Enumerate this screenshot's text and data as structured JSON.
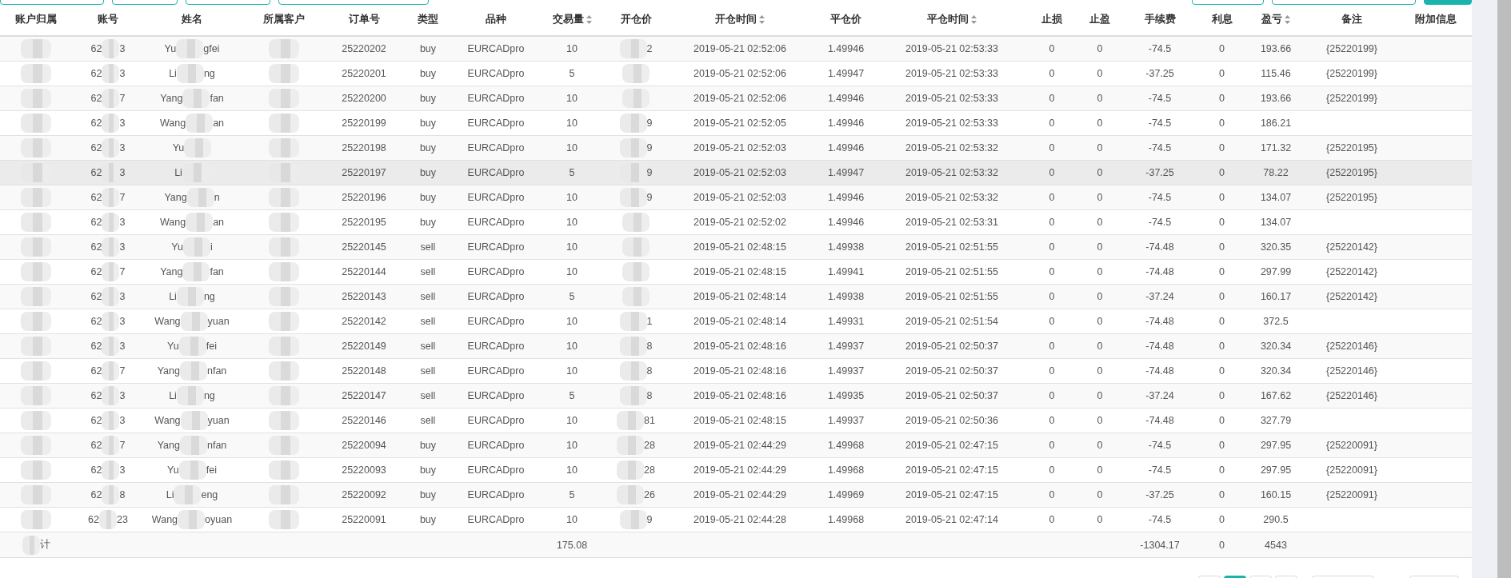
{
  "toolbar_left": [
    {
      "kind": "outline"
    },
    {
      "kind": "outline"
    },
    {
      "kind": "outline"
    },
    {
      "kind": "outline"
    }
  ],
  "toolbar_right": [
    {
      "kind": "outline"
    },
    {
      "kind": "outline"
    },
    {
      "kind": "filled"
    }
  ],
  "columns": [
    {
      "label": "账户归属",
      "sortable": false
    },
    {
      "label": "账号",
      "sortable": false
    },
    {
      "label": "姓名",
      "sortable": false
    },
    {
      "label": "所属客户",
      "sortable": false
    },
    {
      "label": "订单号",
      "sortable": false
    },
    {
      "label": "类型",
      "sortable": false
    },
    {
      "label": "品种",
      "sortable": false
    },
    {
      "label": "交易量",
      "sortable": true
    },
    {
      "label": "开仓价",
      "sortable": false
    },
    {
      "label": "开仓时间",
      "sortable": true
    },
    {
      "label": "平仓价",
      "sortable": false
    },
    {
      "label": "平仓时间",
      "sortable": true
    },
    {
      "label": "止损",
      "sortable": false
    },
    {
      "label": "止盈",
      "sortable": false
    },
    {
      "label": "手续费",
      "sortable": false
    },
    {
      "label": "利息",
      "sortable": false
    },
    {
      "label": "盈亏",
      "sortable": true
    },
    {
      "label": "备注",
      "sortable": false
    },
    {
      "label": "附加信息",
      "sortable": false
    }
  ],
  "rows": [
    {
      "account": [
        "62",
        "3"
      ],
      "name": [
        "Yu",
        "gfei"
      ],
      "order": "25220202",
      "type": "buy",
      "symbol": "EURCADpro",
      "volume": "10",
      "open_price": "2",
      "open_time": "2019-05-21 02:52:06",
      "close_price": "1.49946",
      "close_time": "2019-05-21 02:53:33",
      "sl": "0",
      "tp": "0",
      "fee": "-74.5",
      "interest": "0",
      "pnl": "193.66",
      "note": "{25220199}",
      "hovered": false
    },
    {
      "account": [
        "62",
        "3"
      ],
      "name": [
        "Li",
        "ng"
      ],
      "order": "25220201",
      "type": "buy",
      "symbol": "EURCADpro",
      "volume": "5",
      "open_time": "2019-05-21 02:52:06",
      "close_price": "1.49947",
      "close_time": "2019-05-21 02:53:33",
      "sl": "0",
      "tp": "0",
      "fee": "-37.25",
      "interest": "0",
      "pnl": "115.46",
      "note": "{25220199}",
      "hovered": false
    },
    {
      "account": [
        "62",
        "7"
      ],
      "name": [
        "Yang",
        "fan"
      ],
      "order": "25220200",
      "type": "buy",
      "symbol": "EURCADpro",
      "volume": "10",
      "open_time": "2019-05-21 02:52:06",
      "close_price": "1.49946",
      "close_time": "2019-05-21 02:53:33",
      "sl": "0",
      "tp": "0",
      "fee": "-74.5",
      "interest": "0",
      "pnl": "193.66",
      "note": "{25220199}",
      "hovered": false
    },
    {
      "account": [
        "62",
        "3"
      ],
      "name": [
        "Wang",
        "an"
      ],
      "order": "25220199",
      "type": "buy",
      "symbol": "EURCADpro",
      "volume": "10",
      "open_price": "9",
      "open_time": "2019-05-21 02:52:05",
      "close_price": "1.49946",
      "close_time": "2019-05-21 02:53:33",
      "sl": "0",
      "tp": "0",
      "fee": "-74.5",
      "interest": "0",
      "pnl": "186.21",
      "hovered": false
    },
    {
      "account": [
        "62",
        "3"
      ],
      "name": [
        "Yu"
      ],
      "order": "25220198",
      "type": "buy",
      "symbol": "EURCADpro",
      "volume": "10",
      "open_price": "9",
      "open_time": "2019-05-21 02:52:03",
      "close_price": "1.49946",
      "close_time": "2019-05-21 02:53:32",
      "sl": "0",
      "tp": "0",
      "fee": "-74.5",
      "interest": "0",
      "pnl": "171.32",
      "note": "{25220195}",
      "hovered": false
    },
    {
      "account": [
        "62",
        "3"
      ],
      "name": [
        "Li"
      ],
      "order": "25220197",
      "type": "buy",
      "symbol": "EURCADpro",
      "volume": "5",
      "open_price": "9",
      "open_time": "2019-05-21 02:52:03",
      "close_price": "1.49947",
      "close_time": "2019-05-21 02:53:32",
      "sl": "0",
      "tp": "0",
      "fee": "-37.25",
      "interest": "0",
      "pnl": "78.22",
      "note": "{25220195}",
      "hovered": true
    },
    {
      "account": [
        "62",
        "7"
      ],
      "name": [
        "Yang",
        "n"
      ],
      "order": "25220196",
      "type": "buy",
      "symbol": "EURCADpro",
      "volume": "10",
      "open_price": "9",
      "open_time": "2019-05-21 02:52:03",
      "close_price": "1.49946",
      "close_time": "2019-05-21 02:53:32",
      "sl": "0",
      "tp": "0",
      "fee": "-74.5",
      "interest": "0",
      "pnl": "134.07",
      "note": "{25220195}",
      "hovered": false
    },
    {
      "account": [
        "62",
        "3"
      ],
      "name": [
        "Wang",
        "an"
      ],
      "order": "25220195",
      "type": "buy",
      "symbol": "EURCADpro",
      "volume": "10",
      "open_time": "2019-05-21 02:52:02",
      "close_price": "1.49946",
      "close_time": "2019-05-21 02:53:31",
      "sl": "0",
      "tp": "0",
      "fee": "-74.5",
      "interest": "0",
      "pnl": "134.07",
      "hovered": false
    },
    {
      "account": [
        "62",
        "3"
      ],
      "name": [
        "Yu",
        "i"
      ],
      "order": "25220145",
      "type": "sell",
      "symbol": "EURCADpro",
      "volume": "10",
      "open_time": "2019-05-21 02:48:15",
      "close_price": "1.49938",
      "close_time": "2019-05-21 02:51:55",
      "sl": "0",
      "tp": "0",
      "fee": "-74.48",
      "interest": "0",
      "pnl": "320.35",
      "note": "{25220142}",
      "hovered": false
    },
    {
      "account": [
        "62",
        "7"
      ],
      "name": [
        "Yang",
        "fan"
      ],
      "order": "25220144",
      "type": "sell",
      "symbol": "EURCADpro",
      "volume": "10",
      "open_time": "2019-05-21 02:48:15",
      "close_price": "1.49941",
      "close_time": "2019-05-21 02:51:55",
      "sl": "0",
      "tp": "0",
      "fee": "-74.48",
      "interest": "0",
      "pnl": "297.99",
      "note": "{25220142}",
      "hovered": false
    },
    {
      "account": [
        "62",
        "3"
      ],
      "name": [
        "Li",
        "ng"
      ],
      "order": "25220143",
      "type": "sell",
      "symbol": "EURCADpro",
      "volume": "5",
      "open_time": "2019-05-21 02:48:14",
      "close_price": "1.49938",
      "close_time": "2019-05-21 02:51:55",
      "sl": "0",
      "tp": "0",
      "fee": "-37.24",
      "interest": "0",
      "pnl": "160.17",
      "note": "{25220142}",
      "hovered": false
    },
    {
      "account": [
        "62",
        "3"
      ],
      "name": [
        "Wang",
        "yuan"
      ],
      "order": "25220142",
      "type": "sell",
      "symbol": "EURCADpro",
      "volume": "10",
      "open_price": "1",
      "open_time": "2019-05-21 02:48:14",
      "close_price": "1.49931",
      "close_time": "2019-05-21 02:51:54",
      "sl": "0",
      "tp": "0",
      "fee": "-74.48",
      "interest": "0",
      "pnl": "372.5",
      "hovered": false
    },
    {
      "account": [
        "62",
        "3"
      ],
      "name": [
        "Yu",
        "fei"
      ],
      "order": "25220149",
      "type": "sell",
      "symbol": "EURCADpro",
      "volume": "10",
      "open_price": "8",
      "open_time": "2019-05-21 02:48:16",
      "close_price": "1.49937",
      "close_time": "2019-05-21 02:50:37",
      "sl": "0",
      "tp": "0",
      "fee": "-74.48",
      "interest": "0",
      "pnl": "320.34",
      "note": "{25220146}",
      "hovered": false
    },
    {
      "account": [
        "62",
        "7"
      ],
      "name": [
        "Yang",
        "nfan"
      ],
      "order": "25220148",
      "type": "sell",
      "symbol": "EURCADpro",
      "volume": "10",
      "open_price": "8",
      "open_time": "2019-05-21 02:48:16",
      "close_price": "1.49937",
      "close_time": "2019-05-21 02:50:37",
      "sl": "0",
      "tp": "0",
      "fee": "-74.48",
      "interest": "0",
      "pnl": "320.34",
      "note": "{25220146}",
      "hovered": false
    },
    {
      "account": [
        "62",
        "3"
      ],
      "name": [
        "Li",
        "ng"
      ],
      "order": "25220147",
      "type": "sell",
      "symbol": "EURCADpro",
      "volume": "5",
      "open_price": "8",
      "open_time": "2019-05-21 02:48:16",
      "close_price": "1.49935",
      "close_time": "2019-05-21 02:50:37",
      "sl": "0",
      "tp": "0",
      "fee": "-37.24",
      "interest": "0",
      "pnl": "167.62",
      "note": "{25220146}",
      "hovered": false
    },
    {
      "account": [
        "62",
        "3"
      ],
      "name": [
        "Wang",
        "yuan"
      ],
      "order": "25220146",
      "type": "sell",
      "symbol": "EURCADpro",
      "volume": "10",
      "open_price": "81",
      "open_time": "2019-05-21 02:48:15",
      "close_price": "1.49937",
      "close_time": "2019-05-21 02:50:36",
      "sl": "0",
      "tp": "0",
      "fee": "-74.48",
      "interest": "0",
      "pnl": "327.79",
      "hovered": false
    },
    {
      "account": [
        "62",
        "7"
      ],
      "name": [
        "Yang",
        "nfan"
      ],
      "order": "25220094",
      "type": "buy",
      "symbol": "EURCADpro",
      "volume": "10",
      "open_price": "28",
      "open_time": "2019-05-21 02:44:29",
      "close_price": "1.49968",
      "close_time": "2019-05-21 02:47:15",
      "sl": "0",
      "tp": "0",
      "fee": "-74.5",
      "interest": "0",
      "pnl": "297.95",
      "note": "{25220091}",
      "hovered": false
    },
    {
      "account": [
        "62",
        "3"
      ],
      "name": [
        "Yu",
        "fei"
      ],
      "order": "25220093",
      "type": "buy",
      "symbol": "EURCADpro",
      "volume": "10",
      "open_price": "28",
      "open_time": "2019-05-21 02:44:29",
      "close_price": "1.49968",
      "close_time": "2019-05-21 02:47:15",
      "sl": "0",
      "tp": "0",
      "fee": "-74.5",
      "interest": "0",
      "pnl": "297.95",
      "note": "{25220091}",
      "hovered": false
    },
    {
      "account": [
        "62",
        "8"
      ],
      "name": [
        "Li",
        "eng"
      ],
      "order": "25220092",
      "type": "buy",
      "symbol": "EURCADpro",
      "volume": "5",
      "open_price": "26",
      "open_time": "2019-05-21 02:44:29",
      "close_price": "1.49969",
      "close_time": "2019-05-21 02:47:15",
      "sl": "0",
      "tp": "0",
      "fee": "-37.25",
      "interest": "0",
      "pnl": "160.15",
      "note": "{25220091}",
      "hovered": false
    },
    {
      "account": [
        "62",
        "23"
      ],
      "name": [
        "Wang",
        "oyuan"
      ],
      "order": "25220091",
      "type": "buy",
      "symbol": "EURCADpro",
      "volume": "10",
      "open_price": "9",
      "open_time": "2019-05-21 02:44:28",
      "close_price": "1.49968",
      "close_time": "2019-05-21 02:47:14",
      "sl": "0",
      "tp": "0",
      "fee": "-74.5",
      "interest": "0",
      "pnl": "290.5",
      "hovered": false
    }
  ],
  "footer": {
    "label": "计",
    "volume": "175.08",
    "fee": "-1304.17",
    "interest": "0",
    "pnl": "4543"
  },
  "pagination": [
    {
      "selected": false
    },
    {
      "selected": true
    },
    {
      "selected": false
    },
    {
      "selected": false
    }
  ]
}
